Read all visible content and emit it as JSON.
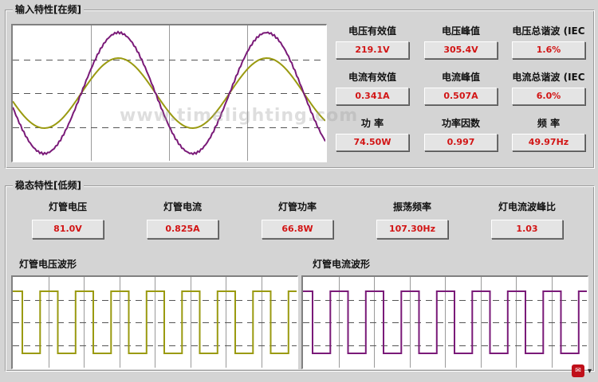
{
  "watermark": "www.timelighting.com",
  "input_section": {
    "title": "输入特性[在频]",
    "metrics": [
      {
        "label": "电压有效值",
        "value": "219.1V"
      },
      {
        "label": "电压峰值",
        "value": "305.4V"
      },
      {
        "label": "电压总谐波 (IEC",
        "value": "1.6%"
      },
      {
        "label": "电流有效值",
        "value": "0.341A"
      },
      {
        "label": "电流峰值",
        "value": "0.507A"
      },
      {
        "label": "电流总谐波 (IEC",
        "value": "6.0%"
      },
      {
        "label": "功    率",
        "value": "74.50W"
      },
      {
        "label": "功率因数",
        "value": "0.997"
      },
      {
        "label": "频    率",
        "value": "49.97Hz"
      }
    ]
  },
  "steady_section": {
    "title": "稳态特性[低频]",
    "metrics": [
      {
        "label": "灯管电压",
        "value": "81.0V"
      },
      {
        "label": "灯管电流",
        "value": "0.825A"
      },
      {
        "label": "灯管功率",
        "value": "66.8W"
      },
      {
        "label": "振荡频率",
        "value": "107.30Hz"
      },
      {
        "label": "灯电流波峰比",
        "value": "1.03"
      }
    ],
    "waveform_labels": {
      "voltage": "灯管电压波形",
      "current": "灯管电流波形"
    }
  },
  "colors": {
    "voltage_wave": "#9a9a10",
    "current_wave": "#7a1a78",
    "value_text": "#d21515"
  },
  "tray": {
    "icon": "app-tray-icon",
    "chevron": "chevron-down-icon"
  }
}
